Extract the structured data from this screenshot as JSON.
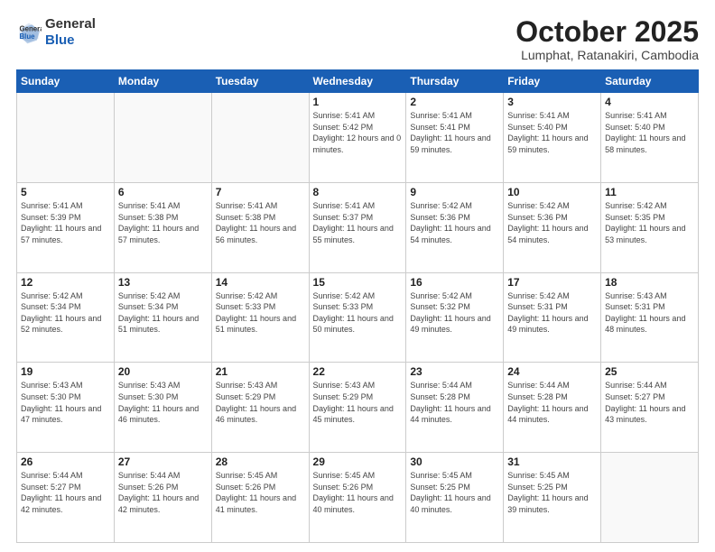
{
  "header": {
    "logo_general": "General",
    "logo_blue": "Blue",
    "month_title": "October 2025",
    "subtitle": "Lumphat, Ratanakiri, Cambodia"
  },
  "days_of_week": [
    "Sunday",
    "Monday",
    "Tuesday",
    "Wednesday",
    "Thursday",
    "Friday",
    "Saturday"
  ],
  "weeks": [
    [
      {
        "day": "",
        "sunrise": "",
        "sunset": "",
        "daylight": "",
        "empty": true
      },
      {
        "day": "",
        "sunrise": "",
        "sunset": "",
        "daylight": "",
        "empty": true
      },
      {
        "day": "",
        "sunrise": "",
        "sunset": "",
        "daylight": "",
        "empty": true
      },
      {
        "day": "1",
        "sunrise": "Sunrise: 5:41 AM",
        "sunset": "Sunset: 5:42 PM",
        "daylight": "Daylight: 12 hours and 0 minutes.",
        "empty": false
      },
      {
        "day": "2",
        "sunrise": "Sunrise: 5:41 AM",
        "sunset": "Sunset: 5:41 PM",
        "daylight": "Daylight: 11 hours and 59 minutes.",
        "empty": false
      },
      {
        "day": "3",
        "sunrise": "Sunrise: 5:41 AM",
        "sunset": "Sunset: 5:40 PM",
        "daylight": "Daylight: 11 hours and 59 minutes.",
        "empty": false
      },
      {
        "day": "4",
        "sunrise": "Sunrise: 5:41 AM",
        "sunset": "Sunset: 5:40 PM",
        "daylight": "Daylight: 11 hours and 58 minutes.",
        "empty": false
      }
    ],
    [
      {
        "day": "5",
        "sunrise": "Sunrise: 5:41 AM",
        "sunset": "Sunset: 5:39 PM",
        "daylight": "Daylight: 11 hours and 57 minutes.",
        "empty": false
      },
      {
        "day": "6",
        "sunrise": "Sunrise: 5:41 AM",
        "sunset": "Sunset: 5:38 PM",
        "daylight": "Daylight: 11 hours and 57 minutes.",
        "empty": false
      },
      {
        "day": "7",
        "sunrise": "Sunrise: 5:41 AM",
        "sunset": "Sunset: 5:38 PM",
        "daylight": "Daylight: 11 hours and 56 minutes.",
        "empty": false
      },
      {
        "day": "8",
        "sunrise": "Sunrise: 5:41 AM",
        "sunset": "Sunset: 5:37 PM",
        "daylight": "Daylight: 11 hours and 55 minutes.",
        "empty": false
      },
      {
        "day": "9",
        "sunrise": "Sunrise: 5:42 AM",
        "sunset": "Sunset: 5:36 PM",
        "daylight": "Daylight: 11 hours and 54 minutes.",
        "empty": false
      },
      {
        "day": "10",
        "sunrise": "Sunrise: 5:42 AM",
        "sunset": "Sunset: 5:36 PM",
        "daylight": "Daylight: 11 hours and 54 minutes.",
        "empty": false
      },
      {
        "day": "11",
        "sunrise": "Sunrise: 5:42 AM",
        "sunset": "Sunset: 5:35 PM",
        "daylight": "Daylight: 11 hours and 53 minutes.",
        "empty": false
      }
    ],
    [
      {
        "day": "12",
        "sunrise": "Sunrise: 5:42 AM",
        "sunset": "Sunset: 5:34 PM",
        "daylight": "Daylight: 11 hours and 52 minutes.",
        "empty": false
      },
      {
        "day": "13",
        "sunrise": "Sunrise: 5:42 AM",
        "sunset": "Sunset: 5:34 PM",
        "daylight": "Daylight: 11 hours and 51 minutes.",
        "empty": false
      },
      {
        "day": "14",
        "sunrise": "Sunrise: 5:42 AM",
        "sunset": "Sunset: 5:33 PM",
        "daylight": "Daylight: 11 hours and 51 minutes.",
        "empty": false
      },
      {
        "day": "15",
        "sunrise": "Sunrise: 5:42 AM",
        "sunset": "Sunset: 5:33 PM",
        "daylight": "Daylight: 11 hours and 50 minutes.",
        "empty": false
      },
      {
        "day": "16",
        "sunrise": "Sunrise: 5:42 AM",
        "sunset": "Sunset: 5:32 PM",
        "daylight": "Daylight: 11 hours and 49 minutes.",
        "empty": false
      },
      {
        "day": "17",
        "sunrise": "Sunrise: 5:42 AM",
        "sunset": "Sunset: 5:31 PM",
        "daylight": "Daylight: 11 hours and 49 minutes.",
        "empty": false
      },
      {
        "day": "18",
        "sunrise": "Sunrise: 5:43 AM",
        "sunset": "Sunset: 5:31 PM",
        "daylight": "Daylight: 11 hours and 48 minutes.",
        "empty": false
      }
    ],
    [
      {
        "day": "19",
        "sunrise": "Sunrise: 5:43 AM",
        "sunset": "Sunset: 5:30 PM",
        "daylight": "Daylight: 11 hours and 47 minutes.",
        "empty": false
      },
      {
        "day": "20",
        "sunrise": "Sunrise: 5:43 AM",
        "sunset": "Sunset: 5:30 PM",
        "daylight": "Daylight: 11 hours and 46 minutes.",
        "empty": false
      },
      {
        "day": "21",
        "sunrise": "Sunrise: 5:43 AM",
        "sunset": "Sunset: 5:29 PM",
        "daylight": "Daylight: 11 hours and 46 minutes.",
        "empty": false
      },
      {
        "day": "22",
        "sunrise": "Sunrise: 5:43 AM",
        "sunset": "Sunset: 5:29 PM",
        "daylight": "Daylight: 11 hours and 45 minutes.",
        "empty": false
      },
      {
        "day": "23",
        "sunrise": "Sunrise: 5:44 AM",
        "sunset": "Sunset: 5:28 PM",
        "daylight": "Daylight: 11 hours and 44 minutes.",
        "empty": false
      },
      {
        "day": "24",
        "sunrise": "Sunrise: 5:44 AM",
        "sunset": "Sunset: 5:28 PM",
        "daylight": "Daylight: 11 hours and 44 minutes.",
        "empty": false
      },
      {
        "day": "25",
        "sunrise": "Sunrise: 5:44 AM",
        "sunset": "Sunset: 5:27 PM",
        "daylight": "Daylight: 11 hours and 43 minutes.",
        "empty": false
      }
    ],
    [
      {
        "day": "26",
        "sunrise": "Sunrise: 5:44 AM",
        "sunset": "Sunset: 5:27 PM",
        "daylight": "Daylight: 11 hours and 42 minutes.",
        "empty": false
      },
      {
        "day": "27",
        "sunrise": "Sunrise: 5:44 AM",
        "sunset": "Sunset: 5:26 PM",
        "daylight": "Daylight: 11 hours and 42 minutes.",
        "empty": false
      },
      {
        "day": "28",
        "sunrise": "Sunrise: 5:45 AM",
        "sunset": "Sunset: 5:26 PM",
        "daylight": "Daylight: 11 hours and 41 minutes.",
        "empty": false
      },
      {
        "day": "29",
        "sunrise": "Sunrise: 5:45 AM",
        "sunset": "Sunset: 5:26 PM",
        "daylight": "Daylight: 11 hours and 40 minutes.",
        "empty": false
      },
      {
        "day": "30",
        "sunrise": "Sunrise: 5:45 AM",
        "sunset": "Sunset: 5:25 PM",
        "daylight": "Daylight: 11 hours and 40 minutes.",
        "empty": false
      },
      {
        "day": "31",
        "sunrise": "Sunrise: 5:45 AM",
        "sunset": "Sunset: 5:25 PM",
        "daylight": "Daylight: 11 hours and 39 minutes.",
        "empty": false
      },
      {
        "day": "",
        "sunrise": "",
        "sunset": "",
        "daylight": "",
        "empty": true
      }
    ]
  ]
}
